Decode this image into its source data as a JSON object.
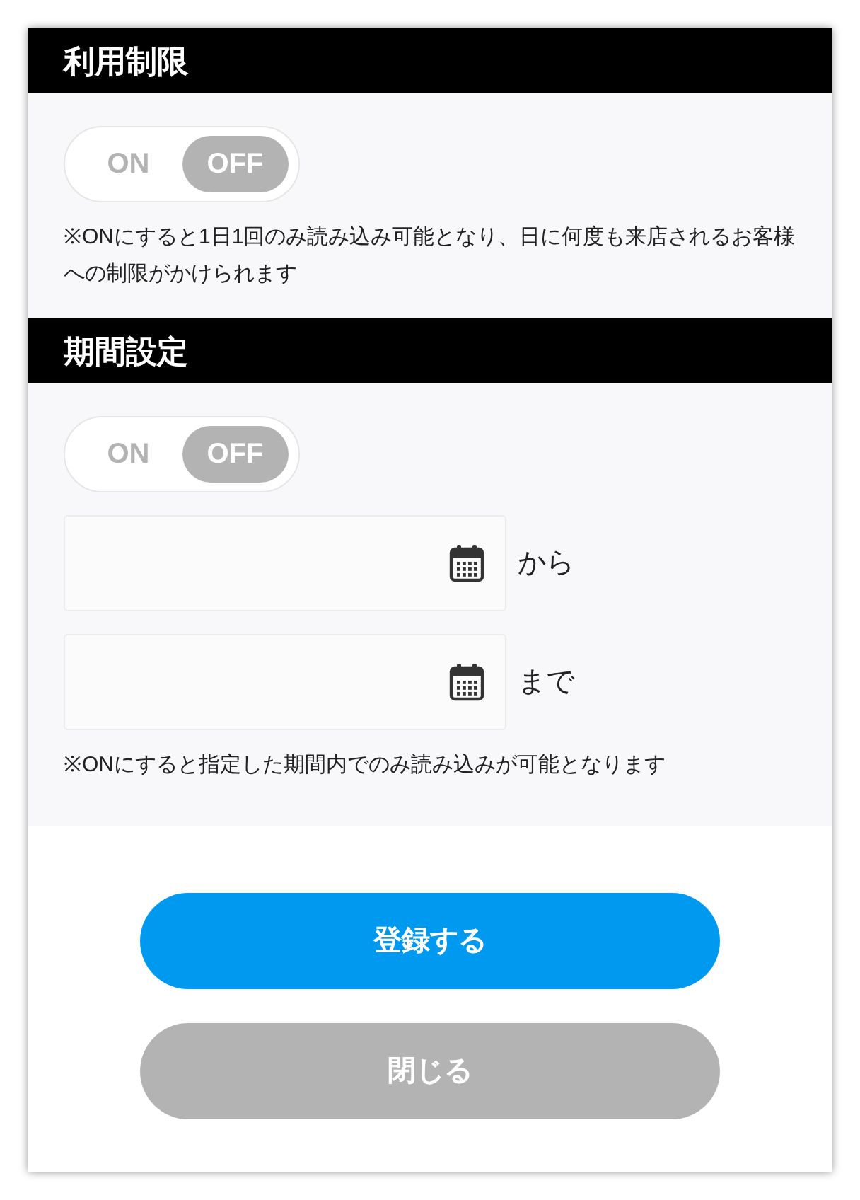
{
  "sections": [
    {
      "title": "利用制限",
      "toggle": {
        "options": [
          {
            "label": "ON",
            "selected": false
          },
          {
            "label": "OFF",
            "selected": true
          }
        ]
      },
      "note": "※ONにすると1日1回のみ読み込み可能となり、日に何度も来店されるお客様への制限がかけられます"
    },
    {
      "title": "期間設定",
      "toggle": {
        "options": [
          {
            "label": "ON",
            "selected": false
          },
          {
            "label": "OFF",
            "selected": true
          }
        ]
      },
      "date_fields": [
        {
          "suffix": "から"
        },
        {
          "suffix": "まで"
        }
      ],
      "note": "※ONにすると指定した期間内でのみ読み込みが可能となります"
    }
  ],
  "buttons": [
    {
      "label": "登録する",
      "kind": "primary"
    },
    {
      "label": "閉じる",
      "kind": "secondary"
    }
  ]
}
